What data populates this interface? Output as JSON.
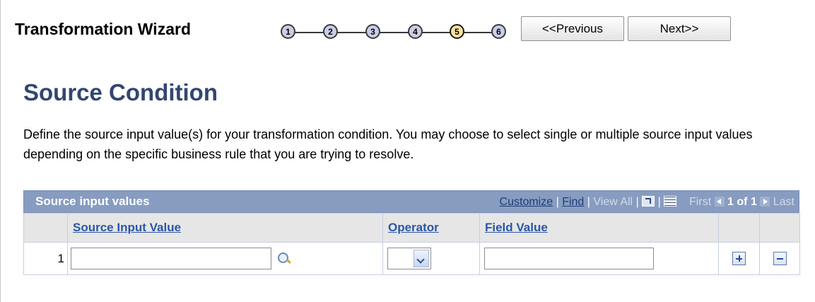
{
  "wizard": {
    "title": "Transformation Wizard",
    "steps": [
      "1",
      "2",
      "3",
      "4",
      "5",
      "6"
    ],
    "active_step": "5",
    "previous_label": "<<Previous",
    "next_label": "Next>>"
  },
  "page": {
    "title": "Source Condition",
    "description": "Define the source input value(s) for your transformation condition. You may choose to select single or multiple source input values depending on the specific business rule that you are trying to resolve."
  },
  "grid": {
    "title": "Source input values",
    "nav": {
      "customize": "Customize",
      "find": "Find",
      "view_all": "View All",
      "first": "First",
      "count": "1 of 1",
      "last": "Last",
      "zoom_icon": "zoom-grid-icon",
      "download_icon": "spreadsheet-icon"
    },
    "columns": [
      "Source Input Value",
      "Operator",
      "Field Value"
    ],
    "rows": [
      {
        "number": "1",
        "source_input_value": "",
        "operator": "",
        "field_value": ""
      }
    ]
  }
}
